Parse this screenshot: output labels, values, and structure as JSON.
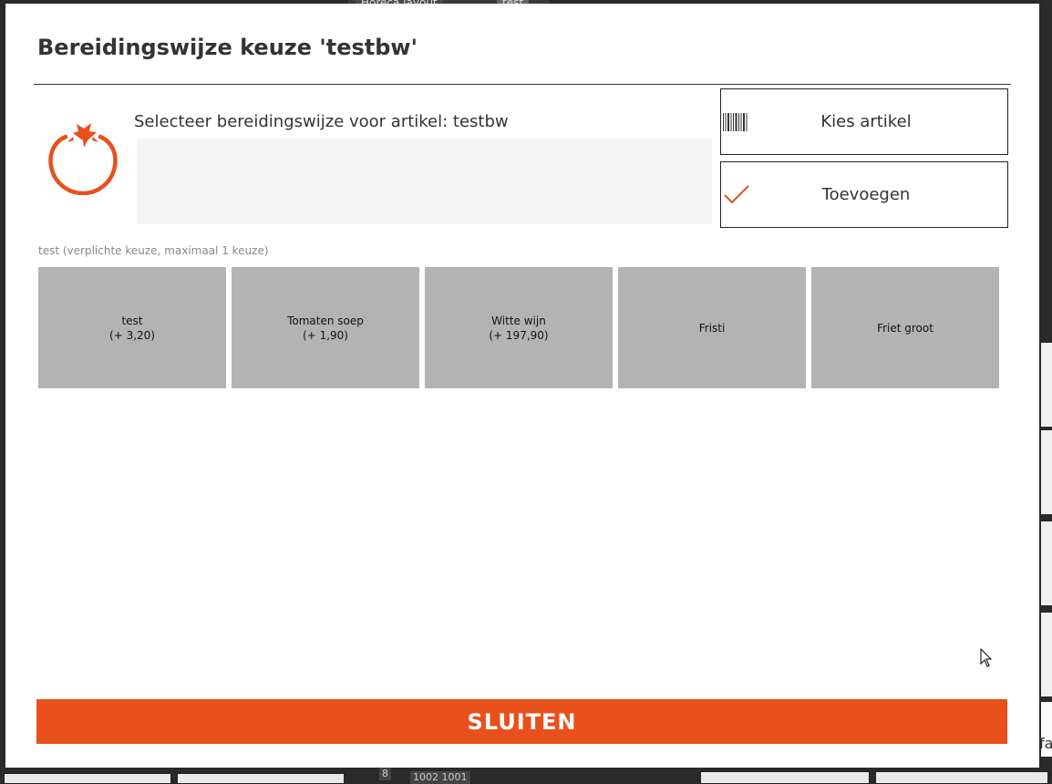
{
  "background": {
    "tab_label": "Horeca layout",
    "tab_label_2": "test",
    "cell_number": "8",
    "cell_codes": "1002 1001",
    "right_fragment": "fa"
  },
  "dialog": {
    "title": "Bereidingswijze keuze 'testbw'",
    "subtitle": "Selecteer bereidingswijze voor artikel: testbw",
    "kies_label": "Kies artikel",
    "toevoegen_label": "Toevoegen",
    "group_label": "test (verplichte keuze, maximaal 1 keuze)",
    "choices": [
      {
        "name": "test",
        "price": "(+ 3,20)"
      },
      {
        "name": "Tomaten soep",
        "price": "(+ 1,90)"
      },
      {
        "name": "Witte wijn",
        "price": "(+ 197,90)"
      },
      {
        "name": "Fristi",
        "price": ""
      },
      {
        "name": "Friet groot",
        "price": ""
      }
    ],
    "close_label": "SLUITEN"
  },
  "colors": {
    "accent": "#e8501c",
    "choice_bg": "#b3b3b3",
    "preview_bg": "#f4f4f4"
  },
  "icons": {
    "logo": "tomato-icon",
    "kies": "barcode-icon",
    "toevoegen": "checkmark-icon"
  }
}
